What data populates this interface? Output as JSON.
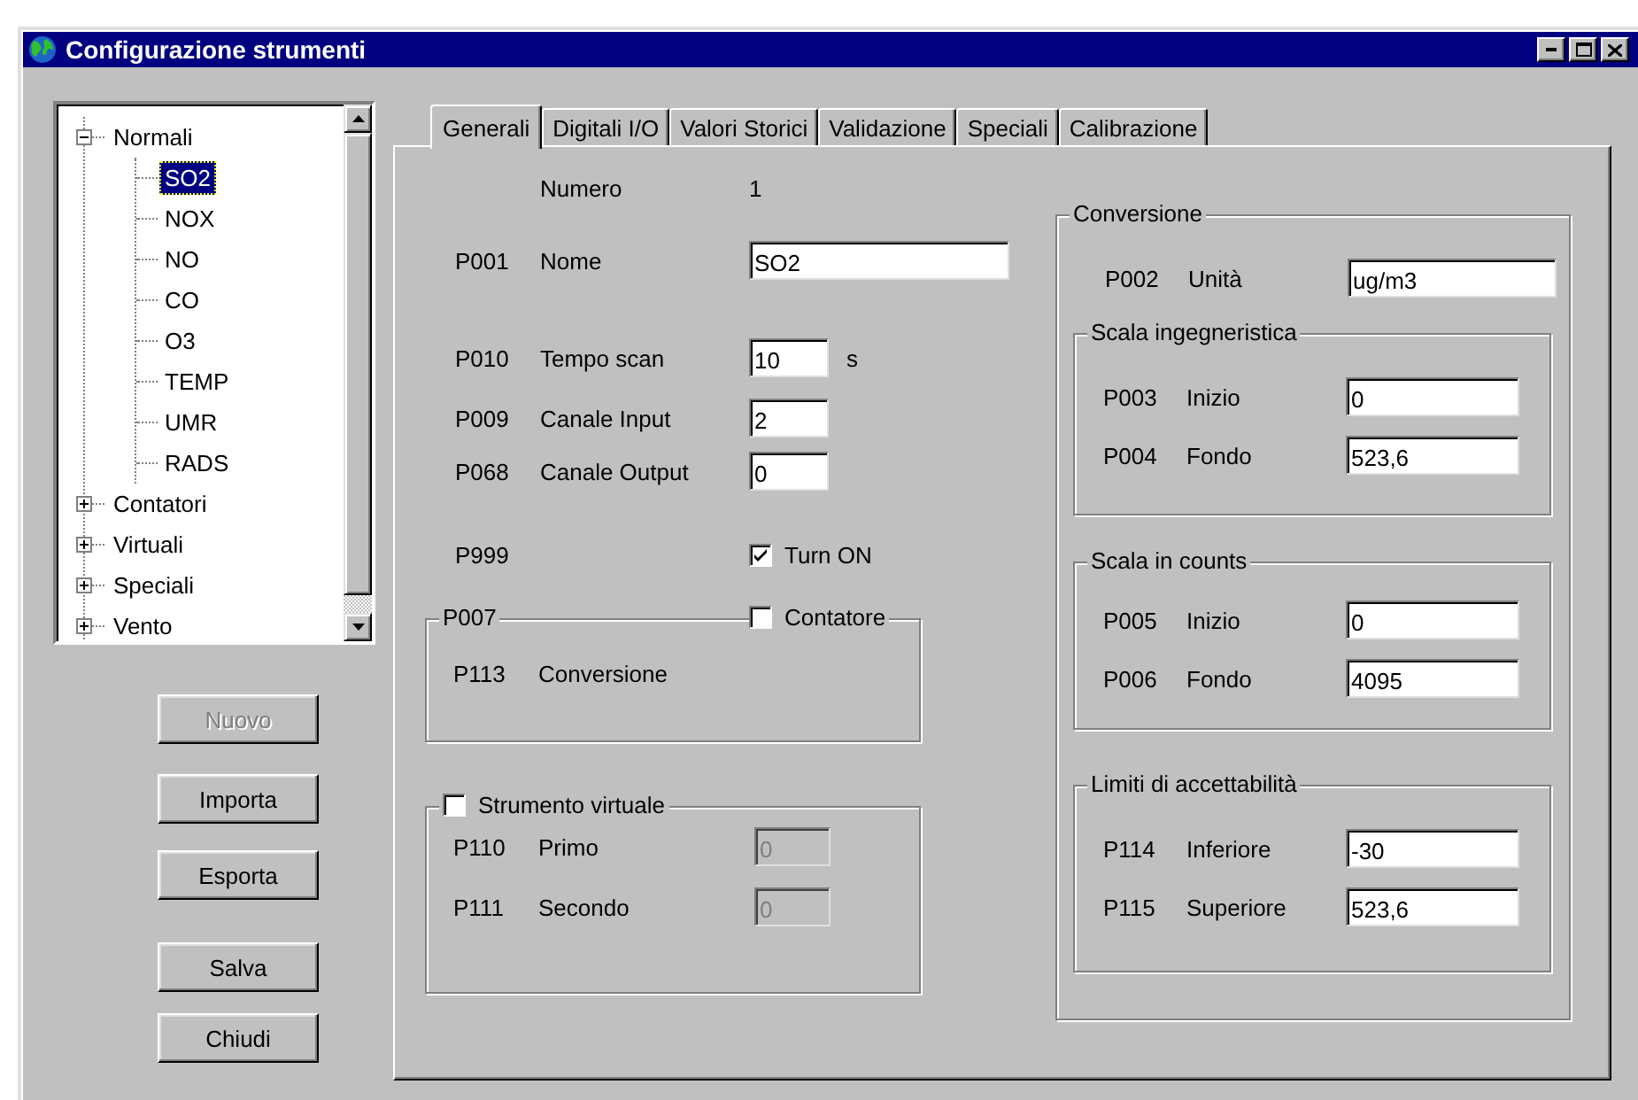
{
  "window": {
    "title": "Configurazione strumenti"
  },
  "tree": {
    "items": [
      {
        "label": "Normali",
        "expanded": true,
        "selected": false,
        "children": [
          {
            "label": "SO2",
            "selected": true
          },
          {
            "label": "NOX",
            "selected": false
          },
          {
            "label": "NO",
            "selected": false
          },
          {
            "label": "CO",
            "selected": false
          },
          {
            "label": "O3",
            "selected": false
          },
          {
            "label": "TEMP",
            "selected": false
          },
          {
            "label": "UMR",
            "selected": false
          },
          {
            "label": "RADS",
            "selected": false
          }
        ]
      },
      {
        "label": "Contatori",
        "expanded": false,
        "selected": false
      },
      {
        "label": "Virtuali",
        "expanded": false,
        "selected": false
      },
      {
        "label": "Speciali",
        "expanded": false,
        "selected": false
      },
      {
        "label": "Vento",
        "expanded": false,
        "selected": false
      }
    ]
  },
  "buttons": [
    {
      "label": "Nuovo",
      "disabled": true
    },
    {
      "label": "Importa",
      "disabled": false
    },
    {
      "label": "Esporta",
      "disabled": false
    },
    {
      "label": "Salva",
      "disabled": false
    },
    {
      "label": "Chiudi",
      "disabled": false
    }
  ],
  "tabs": [
    {
      "label": "Generali",
      "selected": true
    },
    {
      "label": "Digitali I/O",
      "selected": false
    },
    {
      "label": "Valori Storici",
      "selected": false
    },
    {
      "label": "Validazione",
      "selected": false
    },
    {
      "label": "Speciali",
      "selected": false
    },
    {
      "label": "Calibrazione",
      "selected": false
    }
  ],
  "general": {
    "number": {
      "label": "Numero",
      "value": "1"
    },
    "name": {
      "code": "P001",
      "label": "Nome",
      "value": "SO2"
    },
    "scan": {
      "code": "P010",
      "label": "Tempo scan",
      "value": "10",
      "unit": "s"
    },
    "input": {
      "code": "P009",
      "label": "Canale Input",
      "value": "2"
    },
    "output": {
      "code": "P068",
      "label": "Canale Output",
      "value": "0"
    },
    "turn_on": {
      "code": "P999",
      "label": "Turn ON",
      "checked": true
    },
    "counter_group": {
      "code": "P007",
      "label": "Contatore",
      "checked": false,
      "row": {
        "code": "P113",
        "label": "Conversione"
      }
    },
    "virtual_group": {
      "label": "Strumento virtuale",
      "checked": false,
      "fields": [
        {
          "code": "P110",
          "label": "Primo",
          "value": "0",
          "disabled": true
        },
        {
          "code": "P111",
          "label": "Secondo",
          "value": "0",
          "disabled": true
        }
      ]
    }
  },
  "conversion": {
    "title": "Conversione",
    "unit": {
      "code": "P002",
      "label": "Unità",
      "value": "ug/m3"
    },
    "groups": [
      {
        "title": "Scala ingegneristica",
        "fields": [
          {
            "code": "P003",
            "label": "Inizio",
            "value": "0"
          },
          {
            "code": "P004",
            "label": "Fondo",
            "value": "523,6"
          }
        ]
      },
      {
        "title": "Scala in counts",
        "fields": [
          {
            "code": "P005",
            "label": "Inizio",
            "value": "0"
          },
          {
            "code": "P006",
            "label": "Fondo",
            "value": "4095"
          }
        ]
      },
      {
        "title": "Limiti di accettabilità",
        "fields": [
          {
            "code": "P114",
            "label": "Inferiore",
            "value": "-30"
          },
          {
            "code": "P115",
            "label": "Superiore",
            "value": "523,6"
          }
        ]
      }
    ]
  }
}
